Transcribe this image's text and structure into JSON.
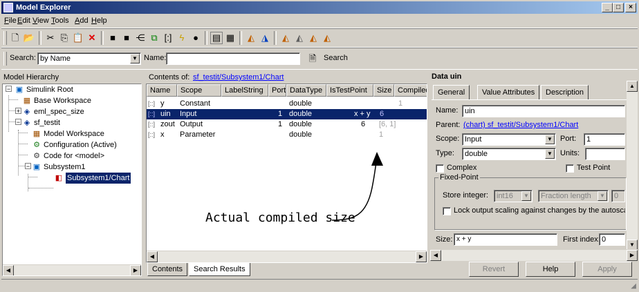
{
  "window": {
    "title": "Model Explorer",
    "min": "_",
    "max": "□",
    "close": "×"
  },
  "menu": [
    {
      "label": "File",
      "key": "F"
    },
    {
      "label": "Edit",
      "key": "E"
    },
    {
      "label": "View",
      "key": "V"
    },
    {
      "label": "Tools",
      "key": "T"
    },
    {
      "label": "Add",
      "key": "A"
    },
    {
      "label": "Help",
      "key": "H"
    }
  ],
  "toolbar_icons": [
    "new-icon",
    "open-icon",
    "cut-icon",
    "copy-icon",
    "paste-icon",
    "delete-icon",
    "block-icon",
    "block2-icon",
    "bus-icon",
    "tree-icon",
    "matrix-icon",
    "lightning-icon",
    "record-icon",
    "list-view-icon",
    "detail-view-icon",
    "add-data-icon",
    "add-event-icon",
    "add-input-icon",
    "add-output-icon",
    "add-param-icon",
    "add-target-icon"
  ],
  "search": {
    "label": "Search:",
    "by": "by Name",
    "name_label": "Name:",
    "name_value": "",
    "button": "Search"
  },
  "hierarchy": {
    "header": "Model Hierarchy",
    "items": [
      {
        "label": "Simulink Root"
      },
      {
        "label": "Base Workspace"
      },
      {
        "label": "eml_spec_size"
      },
      {
        "label": "sf_testit"
      },
      {
        "label": "Model Workspace"
      },
      {
        "label": "Configuration (Active)"
      },
      {
        "label": "Code for <model>"
      },
      {
        "label": "Subsystem1"
      },
      {
        "label": "Subsystem1/Chart"
      }
    ]
  },
  "contents": {
    "prefix": "Contents of:",
    "path": "sf_testit/Subsystem1/Chart",
    "columns": [
      "Name",
      "Scope",
      "LabelString",
      "Port",
      "DataType",
      "IsTestPoint",
      "Size",
      "CompiledSize"
    ],
    "rows": [
      {
        "name": "y",
        "scope": "Constant",
        "label": "",
        "port": "",
        "datatype": "double",
        "testpoint": "",
        "size": "",
        "compiled": "1"
      },
      {
        "name": "uin",
        "scope": "Input",
        "label": "",
        "port": "1",
        "datatype": "double",
        "testpoint": "",
        "size": "x + y",
        "compiled": "6"
      },
      {
        "name": "zout",
        "scope": "Output",
        "label": "",
        "port": "1",
        "datatype": "double",
        "testpoint": "",
        "size": "6",
        "compiled": "[6, 1]"
      },
      {
        "name": "x",
        "scope": "Parameter",
        "label": "",
        "port": "",
        "datatype": "double",
        "testpoint": "",
        "size": "",
        "compiled": "1"
      }
    ],
    "tabs": [
      "Contents",
      "Search Results"
    ],
    "annotation": "Actual compiled size"
  },
  "dialog": {
    "title": "Data uin",
    "tabs": [
      "General",
      "Value Attributes",
      "Description"
    ],
    "name_label": "Name:",
    "name_value": "uin",
    "parent_label": "Parent:",
    "parent_value": "(chart) sf_testit/Subsystem1/Chart",
    "scope_label": "Scope:",
    "scope_value": "Input",
    "port_label": "Port:",
    "port_value": "1",
    "type_label": "Type:",
    "type_value": "double",
    "units_label": "Units:",
    "units_value": "",
    "complex_label": "Complex",
    "testpoint_label": "Test Point",
    "fixed_point": "Fixed-Point",
    "store_integer_label": "Store integer:",
    "store_integer_value": "int16",
    "fraction_label": "Fraction length",
    "fraction_value": "0",
    "lock_label": "Lock output scaling against changes by the autoscalin",
    "size_label": "Size:",
    "size_value": "x + y",
    "first_index_label": "First index:",
    "first_index_value": "0",
    "buttons": {
      "revert": "Revert",
      "help": "Help",
      "apply": "Apply"
    }
  },
  "colors": {
    "selection": "#0a246a",
    "titlebar_start": "#0a246a",
    "titlebar_end": "#a6caf0",
    "face": "#d4d0c8",
    "link": "#0000ff",
    "arrow": "#000000"
  }
}
